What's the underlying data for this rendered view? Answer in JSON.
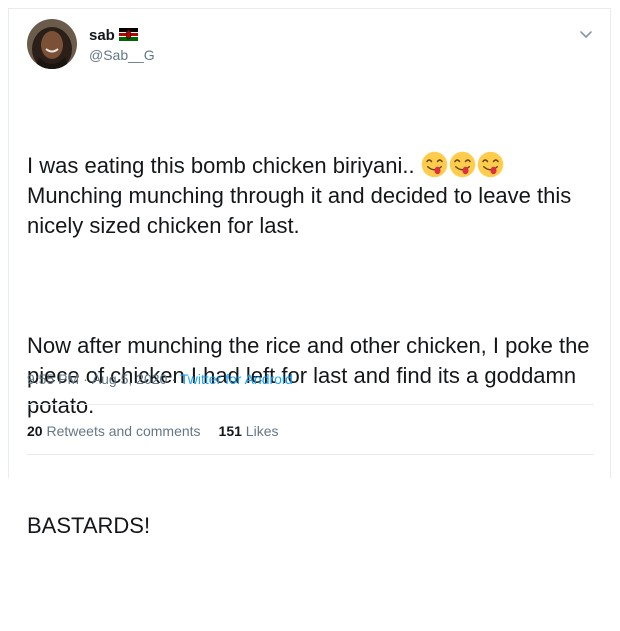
{
  "user": {
    "display_name": "sab",
    "handle": "@Sab__G",
    "flag_icon": "kenya-flag-icon"
  },
  "tweet": {
    "line1": "I was eating this bomb chicken biriyani.. ",
    "emoji_icon": "face-savoring-food-icon",
    "emoji_count": 3,
    "line1_rest": "Munching munching through it and decided to leave this nicely sized chicken for last.",
    "para2": "Now after munching the rice and other chicken, I poke the piece of chicken I had left for last and find its a goddamn potato.",
    "para3": "BASTARDS!"
  },
  "meta": {
    "time": "9:55 PM",
    "separator": "·",
    "date": "Aug 5, 2020",
    "source": "Twitter for Android"
  },
  "stats": {
    "retweets_count": "20",
    "retweets_label": "Retweets and comments",
    "likes_count": "151",
    "likes_label": "Likes"
  },
  "colors": {
    "link": "#1da1f2",
    "secondary_text": "#657786",
    "border": "#e6ecf0"
  }
}
